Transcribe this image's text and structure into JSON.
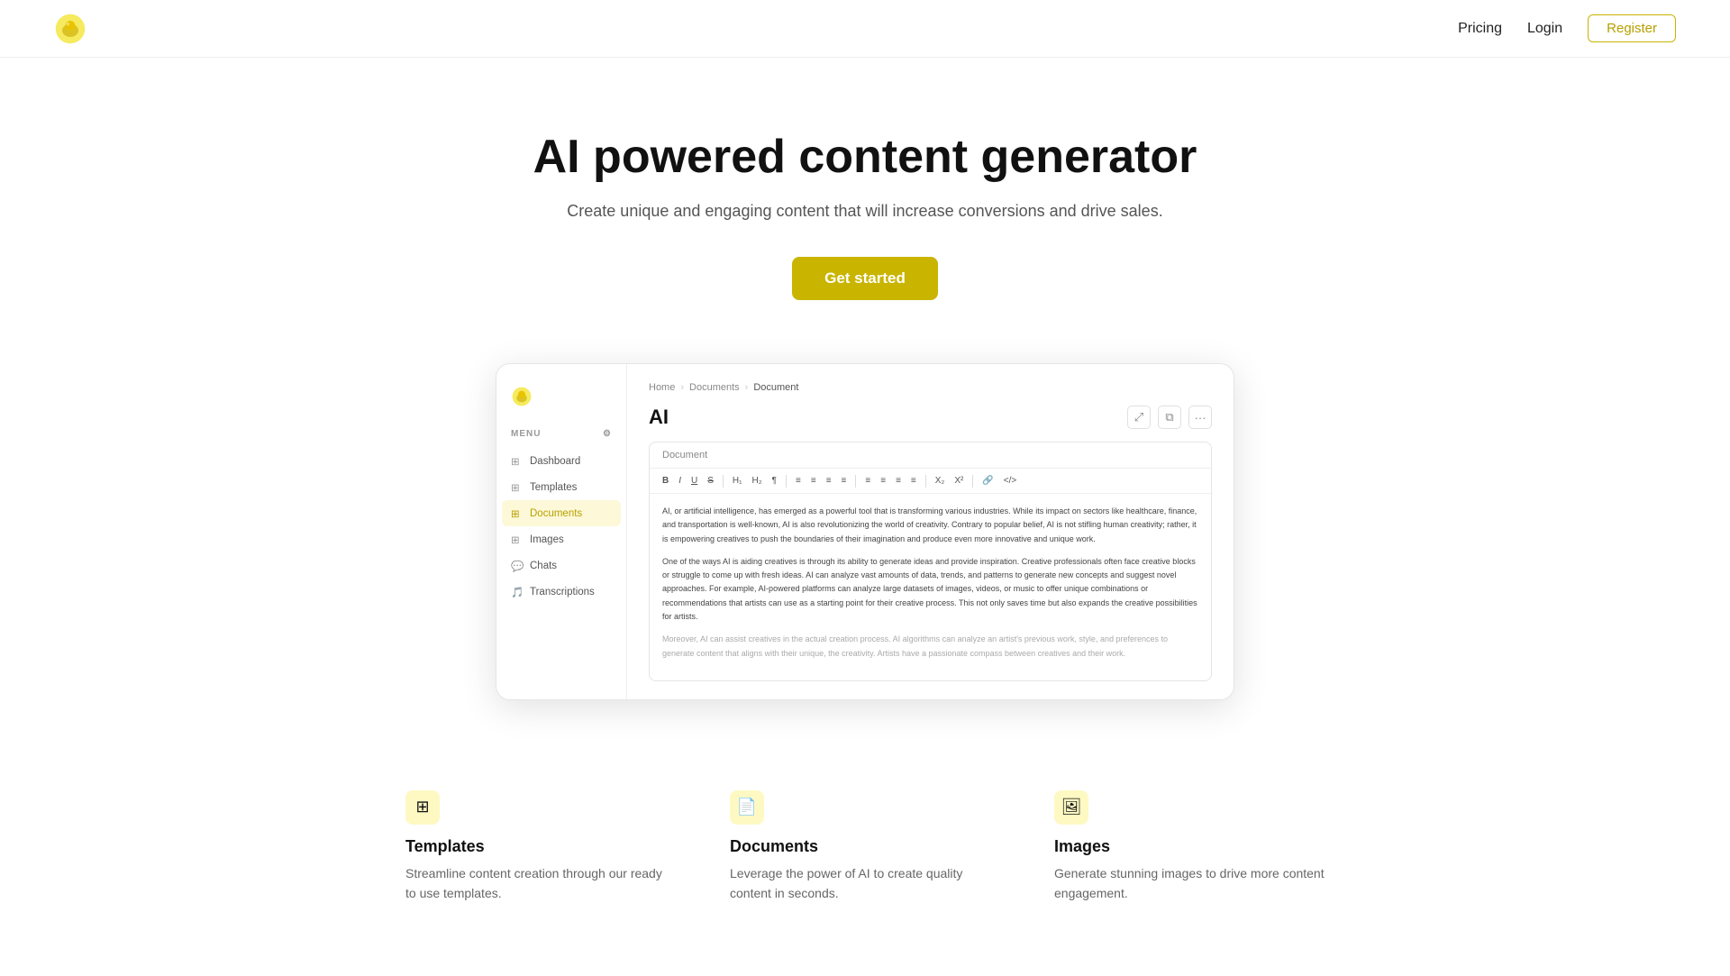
{
  "nav": {
    "pricing_label": "Pricing",
    "login_label": "Login",
    "register_label": "Register"
  },
  "hero": {
    "title": "AI powered content generator",
    "subtitle": "Create unique and engaging content that will increase conversions and drive sales.",
    "cta_label": "Get started"
  },
  "sidebar": {
    "menu_label": "MENU",
    "items": [
      {
        "id": "dashboard",
        "label": "Dashboard",
        "icon": "⊞"
      },
      {
        "id": "templates",
        "label": "Templates",
        "icon": "⊞"
      },
      {
        "id": "documents",
        "label": "Documents",
        "icon": "⊞",
        "active": true
      },
      {
        "id": "images",
        "label": "Images",
        "icon": "⊞"
      },
      {
        "id": "chats",
        "label": "Chats",
        "icon": "💬"
      },
      {
        "id": "transcriptions",
        "label": "Transcriptions",
        "icon": "🎵"
      }
    ]
  },
  "editor": {
    "breadcrumb": {
      "home": "Home",
      "documents": "Documents",
      "current": "Document"
    },
    "doc_name": "AI",
    "editor_label": "Document",
    "toolbar_buttons": [
      "B",
      "I",
      "U",
      "S",
      "H₁",
      "H₂",
      "¶",
      "≡",
      "≡",
      "≡",
      "¶",
      "≡",
      "≡",
      "≡",
      "≡",
      "X₂",
      "X²",
      "🔗",
      "⌘"
    ],
    "body_paragraphs": [
      "AI, or artificial intelligence, has emerged as a powerful tool that is transforming various industries. While its impact on sectors like healthcare, finance, and transportation is well-known, AI is also revolutionizing the world of creativity. Contrary to popular belief, AI is not stifling human creativity; rather, it is empowering creatives to push the boundaries of their imagination and produce even more innovative and unique work.",
      "One of the ways AI is aiding creatives is through its ability to generate ideas and provide inspiration. Creative professionals often face creative blocks or struggle to come up with fresh ideas. AI can analyze vast amounts of data, trends, and patterns to generate new concepts and suggest novel approaches. For example, AI-powered platforms can analyze large datasets of images, videos, or music to offer unique combinations or recommendations that artists can use as a starting point for their creative process. This not only saves time but also expands the creative possibilities for artists.",
      "Moreover, AI can assist creatives in the actual creation process. AI algorithms can analyze an artist's previous work, style, and preferences to generate content that aligns with their unique, the creativity. Artists have a passionate compass between creatives and their work."
    ]
  },
  "features": [
    {
      "id": "templates",
      "title": "Templates",
      "description": "Streamline content creation through our ready to use templates.",
      "icon": "⊞"
    },
    {
      "id": "documents",
      "title": "Documents",
      "description": "Leverage the power of AI to create quality content in seconds.",
      "icon": "📄"
    },
    {
      "id": "images",
      "title": "Images",
      "description": "Generate stunning images to drive more content engagement.",
      "icon": "🖼"
    }
  ]
}
